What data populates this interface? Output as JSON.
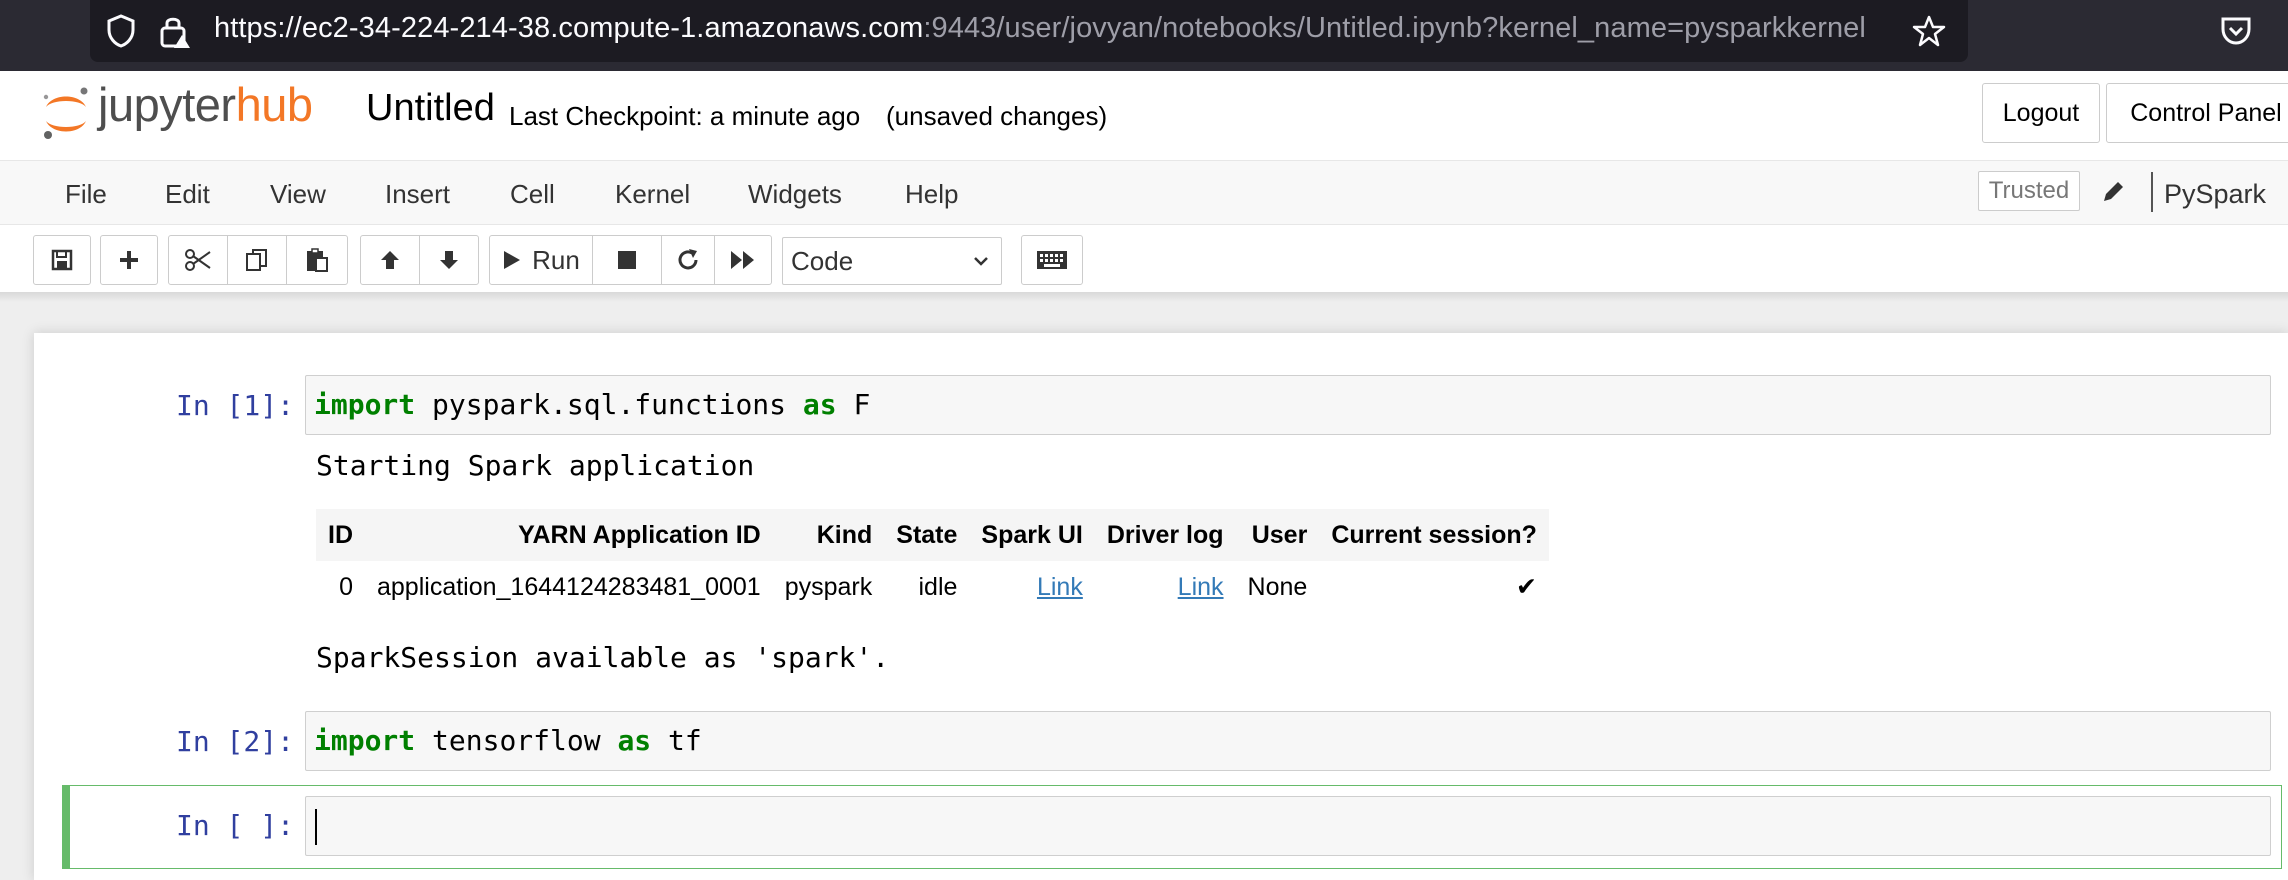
{
  "browser": {
    "url_host": "https://ec2-34-224-214-38.compute-1.amazonaws.com",
    "url_path": ":9443/user/jovyan/notebooks/Untitled.ipynb?kernel_name=pysparkkernel"
  },
  "header": {
    "logo_jupyter": "jupyter",
    "logo_hub": "hub",
    "title": "Untitled",
    "checkpoint": "Last Checkpoint: a minute ago",
    "unsaved": "(unsaved changes)",
    "logout_label": "Logout",
    "control_panel_label": "Control Panel"
  },
  "menubar": {
    "items": [
      "File",
      "Edit",
      "View",
      "Insert",
      "Cell",
      "Kernel",
      "Widgets",
      "Help"
    ],
    "trusted_label": "Trusted",
    "kernel_label": "PySpark"
  },
  "toolbar": {
    "run_label": "Run",
    "cell_type": "Code"
  },
  "cells": [
    {
      "prompt": "In [1]:",
      "code_kw1": "import",
      "code_mid": " pyspark.sql.functions ",
      "code_kw2": "as",
      "code_end": " F",
      "output_start": "Starting Spark application",
      "table": {
        "headers": [
          "ID",
          "YARN Application ID",
          "Kind",
          "State",
          "Spark UI",
          "Driver log",
          "User",
          "Current session?"
        ],
        "row": {
          "id": "0",
          "yarn_id": "application_1644124283481_0001",
          "kind": "pyspark",
          "state": "idle",
          "spark_ui": "Link",
          "driver_log": "Link",
          "user": "None",
          "current": "✔"
        }
      },
      "output_end": "SparkSession available as 'spark'."
    },
    {
      "prompt": "In [2]:",
      "code_kw1": "import",
      "code_mid": " tensorflow ",
      "code_kw2": "as",
      "code_end": " tf"
    },
    {
      "prompt": "In [ ]:"
    }
  ],
  "colors": {
    "accent_orange": "#f37726",
    "prompt_blue": "#303f9f",
    "keyword_green": "#008000",
    "selected_border": "#66bb6a"
  }
}
